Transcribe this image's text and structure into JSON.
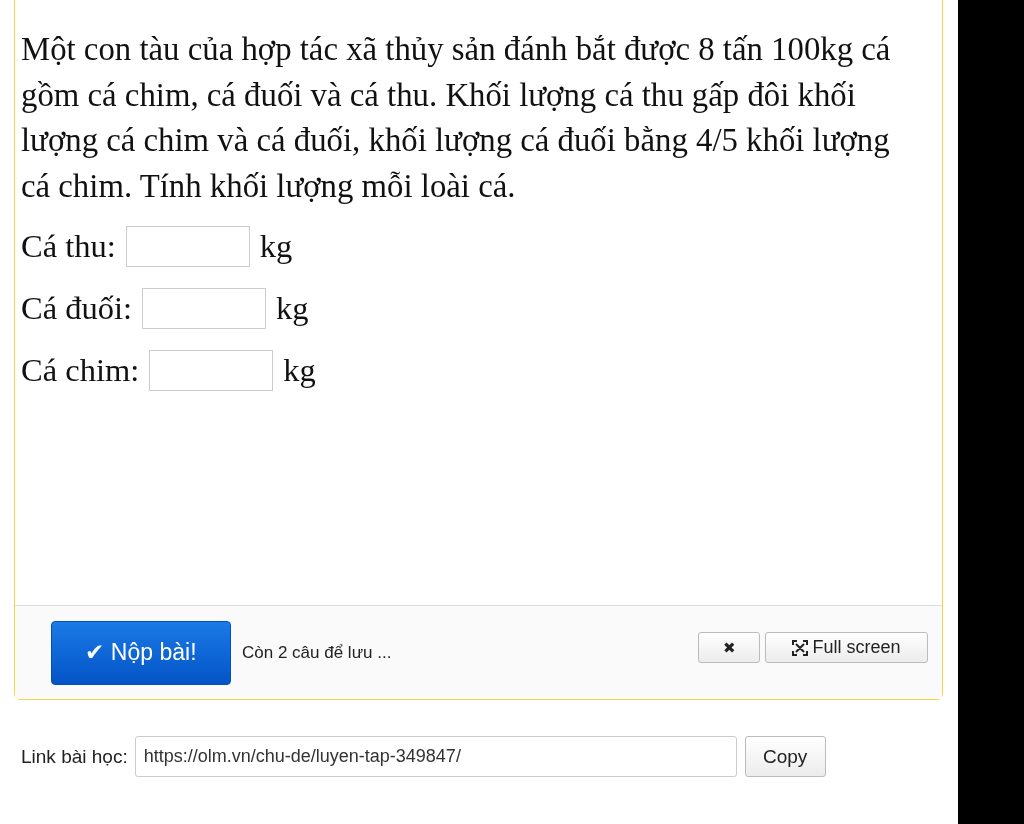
{
  "question": {
    "text": "Một con tàu của hợp tác xã thủy sản đánh bắt được 8 tấn 100kg cá gồm cá chim, cá đuối và cá thu. Khối lượng cá thu gấp đôi khối lượng cá chim và cá đuối, khối lượng cá đuối bằng 4/5 khối lượng cá chim. Tính khối lượng mỗi loài cá.",
    "answers": [
      {
        "label": "Cá thu:",
        "unit": "kg"
      },
      {
        "label": "Cá đuối:",
        "unit": "kg"
      },
      {
        "label": "Cá chim:",
        "unit": "kg"
      }
    ]
  },
  "footer": {
    "submit": "✔ Nộp bài!",
    "status": "Còn 2 câu để lưu ...",
    "close": "✖",
    "fullscreen": "Full screen"
  },
  "link": {
    "label": "Link bài học:",
    "value": "https://olm.vn/chu-de/luyen-tap-349847/",
    "copy": "Copy"
  }
}
